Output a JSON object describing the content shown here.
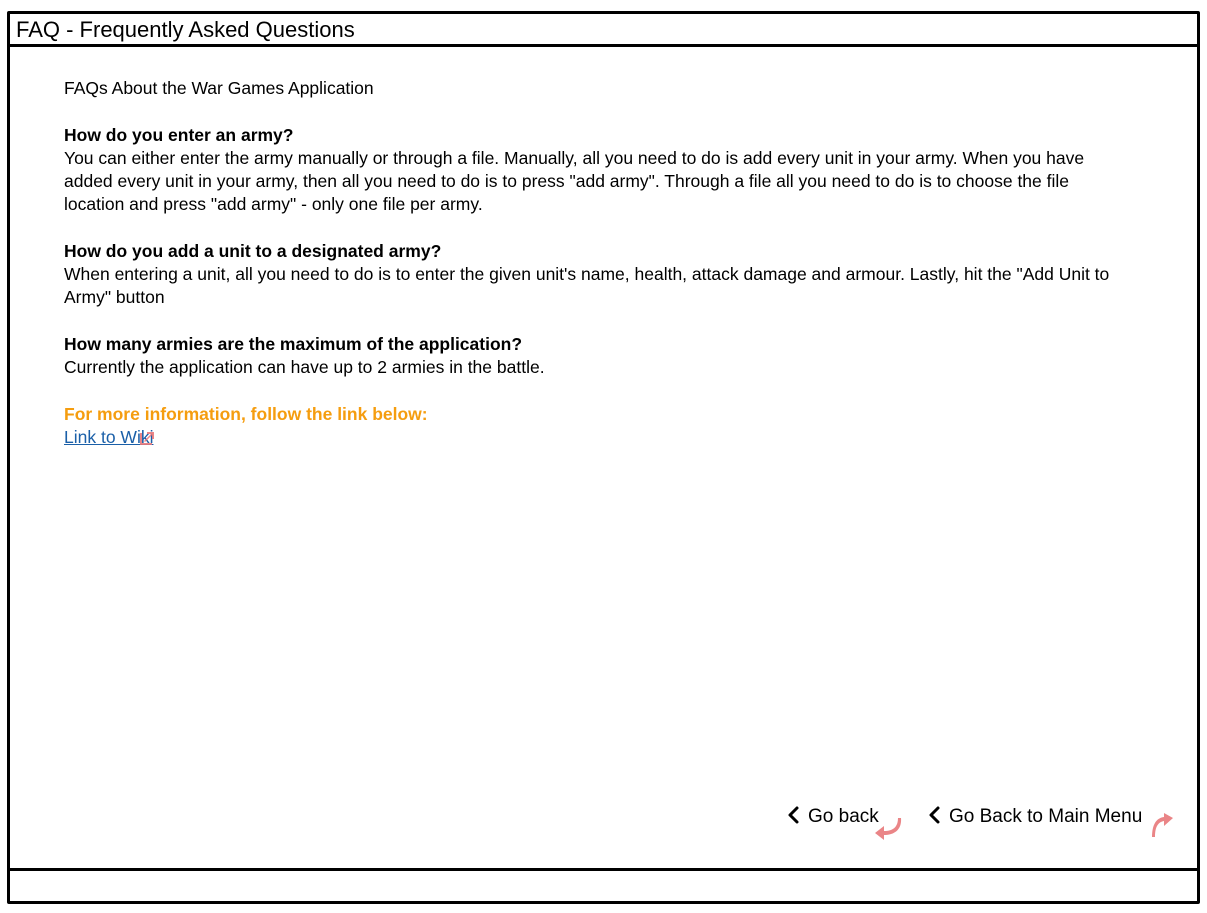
{
  "window": {
    "title": "FAQ - Frequently Asked Questions"
  },
  "intro": "FAQs About the War Games Application",
  "faq": [
    {
      "question": "How do you enter an army?",
      "answer": "You can either enter the army manually or through a file. Manually, all you need to do is add every unit in your army. When you have added every unit in your army, then all you need to do is to press \"add army\". Through a file all you need to do is to choose the file location and press \"add army\" - only one file per army."
    },
    {
      "question": "How do you add a unit to a designated army?",
      "answer": "When entering a unit, all you need to do is to enter the given unit's name, health, attack damage and armour. Lastly, hit the \"Add Unit to Army\" button"
    },
    {
      "question": "How many armies are the maximum of the application?",
      "answer": "Currently the application can have up to 2 armies in the battle."
    }
  ],
  "more_info": {
    "label": "For more information, follow the link below:",
    "link_text": "Link to Wiki"
  },
  "nav": {
    "go_back": "Go back",
    "go_back_main": "Go Back to Main Menu"
  },
  "colors": {
    "more_info_text": "#f59d0f",
    "link_text": "#1a5fa8",
    "link_marker": "#e8787a"
  },
  "icons": {
    "link_marker": "external-link-arrow-icon",
    "nav_chevron": "chevron-left-icon",
    "back_marker": "curved-arrow-back-icon",
    "main_marker": "curved-arrow-up-icon"
  }
}
